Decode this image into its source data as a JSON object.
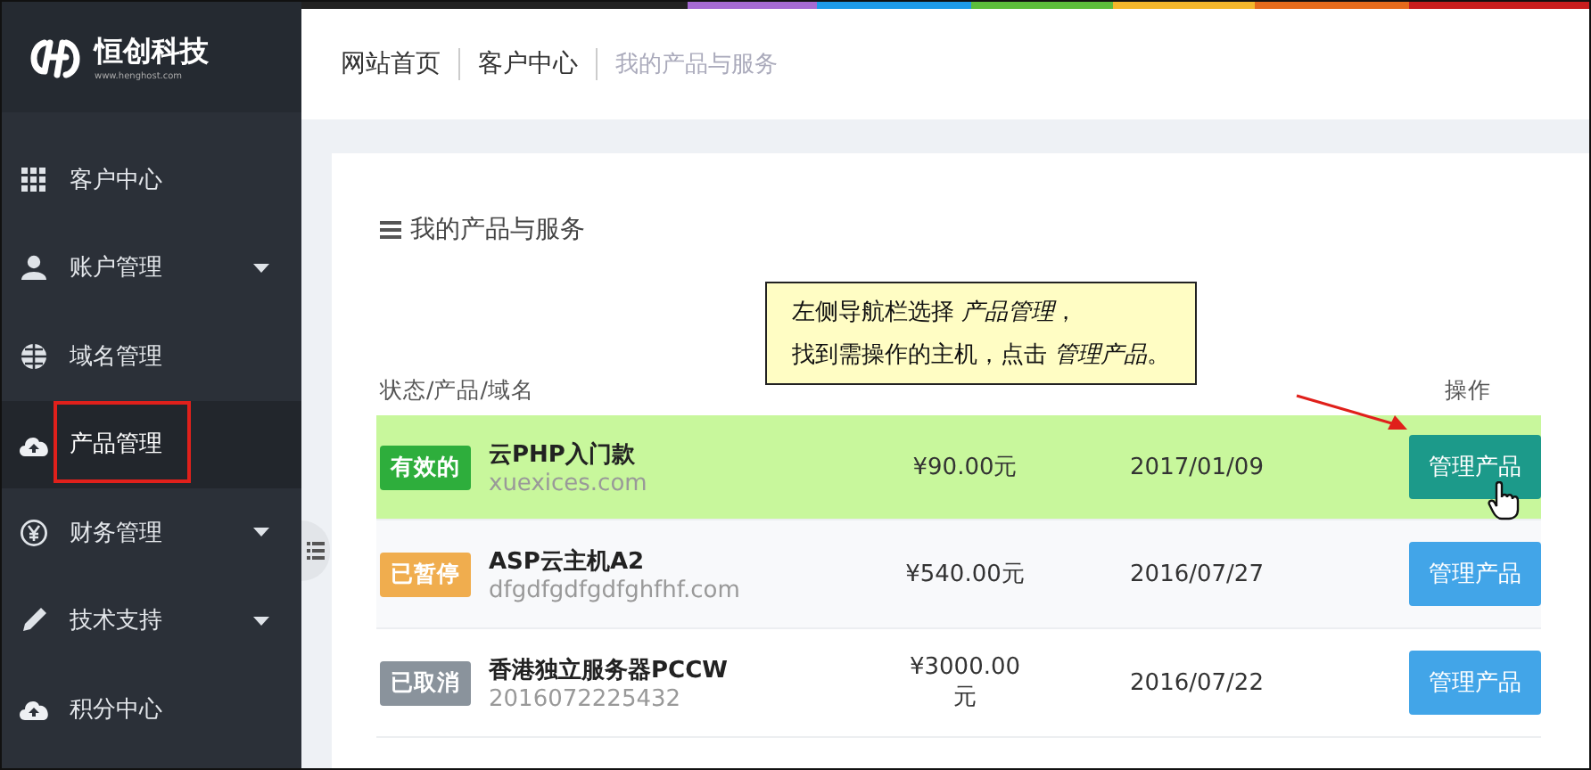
{
  "logo": {
    "name": "恒创科技",
    "url": "www.henghost.com"
  },
  "sidebar": {
    "items": [
      {
        "label": "客户中心",
        "selected": false,
        "has_submenu": false,
        "annotated": false
      },
      {
        "label": "账户管理",
        "selected": false,
        "has_submenu": true,
        "annotated": false
      },
      {
        "label": "域名管理",
        "selected": false,
        "has_submenu": false,
        "annotated": false
      },
      {
        "label": "产品管理",
        "selected": true,
        "has_submenu": false,
        "annotated": true
      },
      {
        "label": "财务管理",
        "selected": false,
        "has_submenu": true,
        "annotated": false
      },
      {
        "label": "技术支持",
        "selected": false,
        "has_submenu": true,
        "annotated": false
      },
      {
        "label": "积分中心",
        "selected": false,
        "has_submenu": false,
        "annotated": false
      }
    ]
  },
  "breadcrumb": [
    {
      "label": "网站首页",
      "current": false
    },
    {
      "label": "客户中心",
      "current": false
    },
    {
      "label": "我的产品与服务",
      "current": true
    }
  ],
  "card": {
    "title": "我的产品与服务",
    "callout": [
      "左侧导航栏选择 *产品管理*，",
      "找到需操作的主机，点击 *管理产品*。"
    ],
    "table": {
      "columns": [
        "状态/产品/域名",
        "操作"
      ],
      "rows": [
        {
          "status": {
            "label": "有效的",
            "color": "#2eae3c"
          },
          "product": "云PHP入门款",
          "domain": "xuexices.com",
          "price": "¥90.00元",
          "date": "2017/01/09",
          "action": "管理产品",
          "highlighted": true,
          "hovered": true
        },
        {
          "status": {
            "label": "已暂停",
            "color": "#f0ad4e"
          },
          "product": "ASP云主机A2",
          "domain": "dfgdfgdfgdfghfhf.com",
          "price": "¥540.00元",
          "date": "2016/07/27",
          "action": "管理产品",
          "highlighted": false,
          "hovered": false
        },
        {
          "status": {
            "label": "已取消",
            "color": "#8a939c"
          },
          "product": "香港独立服务器PCCW",
          "domain": "2016072225432",
          "price": "¥3000.00元",
          "date": "2016/07/22",
          "action": "管理产品",
          "highlighted": false,
          "hovered": false
        }
      ]
    }
  }
}
